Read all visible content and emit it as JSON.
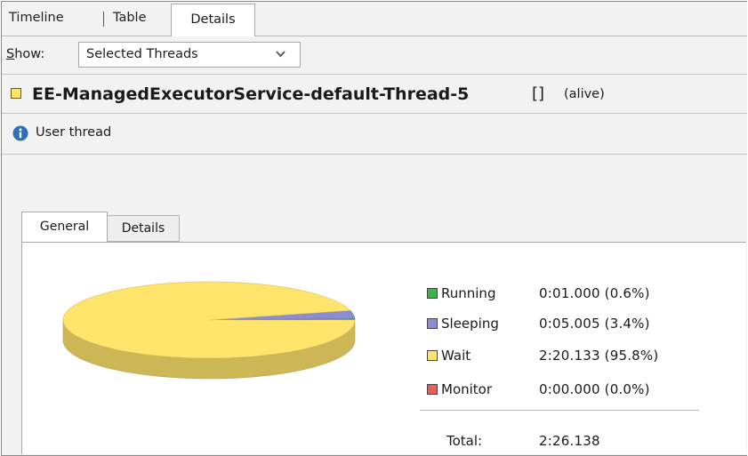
{
  "view_tabs": [
    "Timeline",
    "Table",
    "Details"
  ],
  "active_view_tab": "Details",
  "show": {
    "label_prefix": "S",
    "label_rest": "how:",
    "selected": "Selected Threads"
  },
  "thread": {
    "name": "EE-ManagedExecutorService-default-Thread-5",
    "extra": "[]",
    "state": "(alive)",
    "swatch_color": "#ffe46b"
  },
  "info": {
    "text": "User thread",
    "icon": "info-icon"
  },
  "inner_tabs": {
    "general": "General",
    "details": "Details",
    "active": "General"
  },
  "chart_data": {
    "type": "pie",
    "slices": [
      {
        "name": "Running",
        "value": 0.6,
        "time": "0:01.000",
        "percent": "(0.6%)",
        "color": "#3cb44b"
      },
      {
        "name": "Sleeping",
        "value": 3.4,
        "time": "0:05.005",
        "percent": "(3.4%)",
        "color": "#8c8cd2"
      },
      {
        "name": "Wait",
        "value": 95.8,
        "time": "2:20.133",
        "percent": "(95.8%)",
        "color": "#ffe46b"
      },
      {
        "name": "Monitor",
        "value": 0.0,
        "time": "0:00.000",
        "percent": "(0.0%)",
        "color": "#e8605a"
      }
    ],
    "total_label": "Total:",
    "total_value": "2:26.138"
  }
}
